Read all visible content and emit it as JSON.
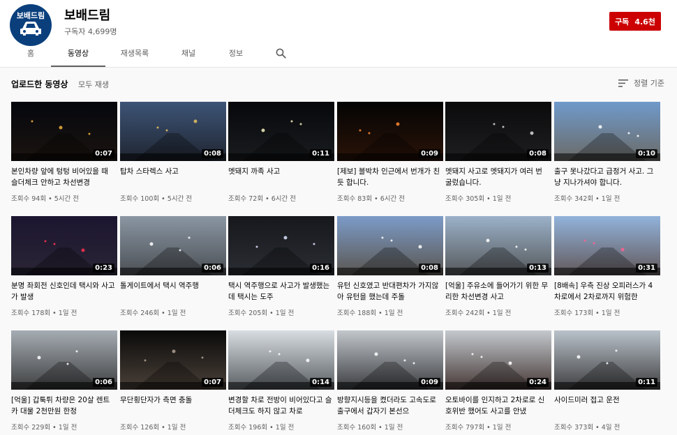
{
  "channel": {
    "avatar_text": "보배드림",
    "name": "보배드림",
    "subscribers": "구독자 4,699명",
    "subscribe_label": "구독",
    "subscribe_count": "4.6천"
  },
  "tabs": [
    {
      "label": "홈"
    },
    {
      "label": "동영상"
    },
    {
      "label": "재생목록"
    },
    {
      "label": "채널"
    },
    {
      "label": "정보"
    }
  ],
  "section": {
    "title": "업로드한 동영상",
    "play_all": "모두 재생",
    "sort_label": "정렬 기준"
  },
  "videos": [
    {
      "title": "본인차량 앞에 텅텅 비어있을 때 슬더체크 안하고 차선변경",
      "views": "조회수 94회",
      "age": "5시간 전",
      "duration": "0:07",
      "thumb": [
        "#05070d",
        "#1b1410"
      ],
      "light": "#f0b040"
    },
    {
      "title": "탑차 스타렉스 사고",
      "views": "조회수 100회",
      "age": "5시간 전",
      "duration": "0:08",
      "thumb": [
        "#3d5477",
        "#1f2530"
      ],
      "light": "#e8c060"
    },
    {
      "title": "멧돼지 까족 사고",
      "views": "조회수 72회",
      "age": "6시간 전",
      "duration": "0:11",
      "thumb": [
        "#07080b",
        "#191c1e"
      ],
      "light": "#f3f0c0"
    },
    {
      "title": "[제보] 블박차 인근에서 번개가 친 듯 합니다.",
      "views": "조회수 83회",
      "age": "6시간 전",
      "duration": "0:09",
      "thumb": [
        "#040404",
        "#2a1308"
      ],
      "light": "#ff8a30"
    },
    {
      "title": "멧돼지 사고로 멧돼지가 여러 번 굴렀습니다.",
      "views": "조회수 305회",
      "age": "1일 전",
      "duration": "0:08",
      "thumb": [
        "#0b0b0c",
        "#1e1e20"
      ],
      "light": "#d8d8d8"
    },
    {
      "title": "출구 못나갔다고 급정거 사고. 그냥 지나가셔야 합니다.",
      "views": "조회수 342회",
      "age": "1일 전",
      "duration": "0:10",
      "thumb": [
        "#6f9acb",
        "#6b6a66"
      ],
      "light": "#ffffff"
    },
    {
      "title": "분명 좌회전 신호인데 택시와 사고가 발생",
      "views": "조회수 178회",
      "age": "1일 전",
      "duration": "0:23",
      "thumb": [
        "#1c1530",
        "#2a2535"
      ],
      "light": "#ff3050"
    },
    {
      "title": "톨게이트에서 택시 역주행",
      "views": "조회수 246회",
      "age": "1일 전",
      "duration": "0:06",
      "thumb": [
        "#8a96a3",
        "#4b4f54"
      ],
      "light": "#ffffff"
    },
    {
      "title": "택시 역주행으로 사고가 발생했는데 택시는 도주",
      "views": "조회수 205회",
      "age": "1일 전",
      "duration": "0:16",
      "thumb": [
        "#16181c",
        "#2a2d33"
      ],
      "light": "#e0e8ff"
    },
    {
      "title": "유턴 신호였고 반대편차가 가지않아 유턴을 했는데 주돌",
      "views": "조회수 188회",
      "age": "1일 전",
      "duration": "0:08",
      "thumb": [
        "#7c9bc8",
        "#5a5650"
      ],
      "light": "#ffffff"
    },
    {
      "title": "[억울] 주유소에 들어가기 위한 무리한 차선변경 사고",
      "views": "조회수 242회",
      "age": "1일 전",
      "duration": "0:13",
      "thumb": [
        "#9bb1c9",
        "#55585a"
      ],
      "light": "#ffffff"
    },
    {
      "title": "[8배속] 우측 진상 오피러스가 4차로에서 2차로까지 위험한",
      "views": "조회수 173회",
      "age": "1일 전",
      "duration": "0:31",
      "thumb": [
        "#92b3db",
        "#62585a"
      ],
      "light": "#ff6090"
    },
    {
      "title": "[억울] 갑툭튀 차량은 20살 렌트카 대물 2천만원 한정",
      "views": "조회수 229회",
      "age": "1일 전",
      "duration": "0:06",
      "thumb": [
        "#a5acb3",
        "#3e3f40"
      ],
      "light": "#ffffff"
    },
    {
      "title": "무단횡단자가 측면 충돌",
      "views": "조회수 126회",
      "age": "1일 전",
      "duration": "0:07",
      "thumb": [
        "#0a0a0a",
        "#4a4038"
      ],
      "light": "#b0a090"
    },
    {
      "title": "변경할 차로 전방이 비어있다고 슬더체크도 하지 않고 차로",
      "views": "조회수 196회",
      "age": "1일 전",
      "duration": "0:14",
      "thumb": [
        "#d8dde2",
        "#5a5f64"
      ],
      "light": "#ffffff"
    },
    {
      "title": "방향지시등을 켰더라도 고속도로 출구에서 갑자기 본선으",
      "views": "조회수 160회",
      "age": "1일 전",
      "duration": "0:09",
      "thumb": [
        "#c2c7cc",
        "#3b3d40"
      ],
      "light": "#ffffff"
    },
    {
      "title": "오토바이를 인지하고 2차로로 신호위반 했어도 사고를 안냈",
      "views": "조회수 797회",
      "age": "1일 전",
      "duration": "0:24",
      "thumb": [
        "#c4c9ce",
        "#463836"
      ],
      "light": "#ffffff"
    },
    {
      "title": "사이드미러 접고 운전",
      "views": "조회수 373회",
      "age": "4일 전",
      "duration": "0:11",
      "thumb": [
        "#b9c2cb",
        "#3f3f40"
      ],
      "light": "#ffffff"
    }
  ]
}
